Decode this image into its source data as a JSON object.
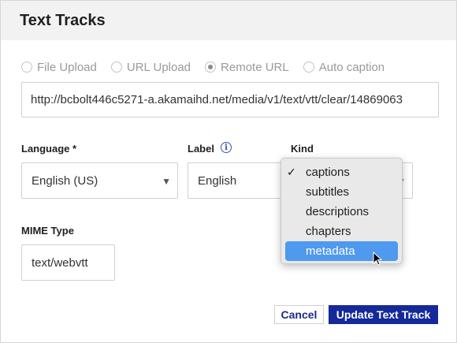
{
  "dialog": {
    "title": "Text Tracks"
  },
  "source_options": [
    {
      "label": "File Upload",
      "checked": false
    },
    {
      "label": "URL Upload",
      "checked": false
    },
    {
      "label": "Remote URL",
      "checked": true
    },
    {
      "label": "Auto caption",
      "checked": false
    }
  ],
  "url": {
    "value": "http://bcbolt446c5271-a.akamaihd.net/media/v1/text/vtt/clear/14869063"
  },
  "language": {
    "label": "Language *",
    "value": "English (US)"
  },
  "label_field": {
    "label": "Label",
    "value": "English"
  },
  "kind": {
    "label": "Kind",
    "options": [
      "captions",
      "subtitles",
      "descriptions",
      "chapters",
      "metadata"
    ],
    "selected": "captions",
    "highlighted": "metadata"
  },
  "mime": {
    "label": "MIME Type",
    "value": "text/webvtt"
  },
  "buttons": {
    "cancel": "Cancel",
    "update": "Update Text Track"
  },
  "colors": {
    "primary": "#15299a",
    "highlight": "#4f99ee",
    "header_bg": "#f2f2f2"
  }
}
